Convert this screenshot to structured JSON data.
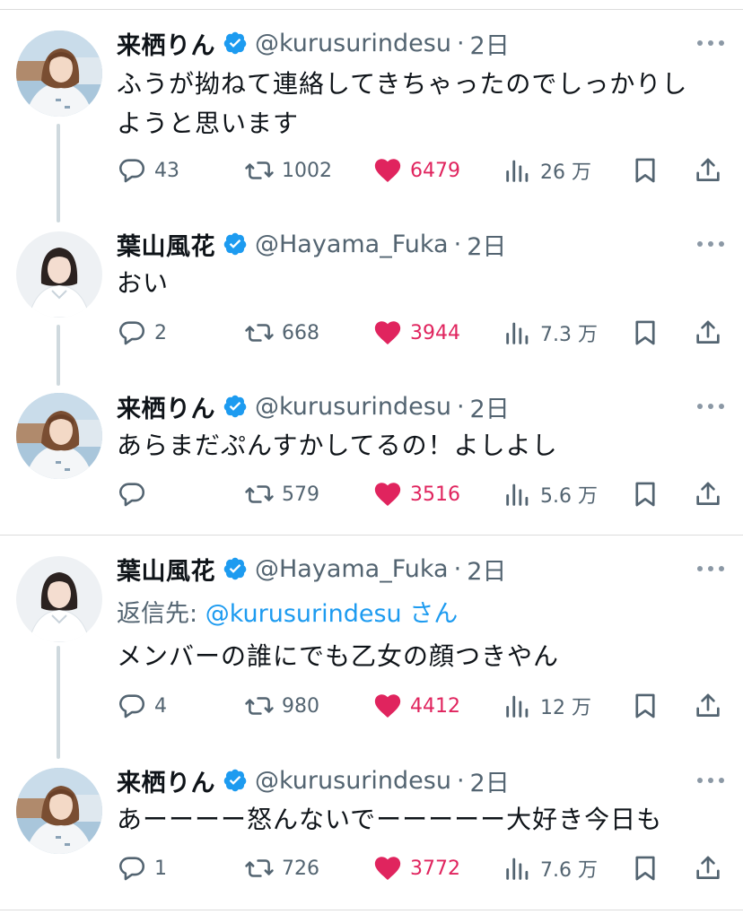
{
  "colors": {
    "accent": "#1d9bf0",
    "like": "#e0245e",
    "muted": "#536471",
    "text": "#0f1419"
  },
  "tweets": [
    {
      "name": "来栖りん",
      "handle": "@kurusurindesu",
      "dot": "·",
      "time": "2日",
      "text_lines": [
        "ふうが拗ねて連絡してきちゃったのでしっかりし",
        "ようと思います"
      ],
      "reply_count": "43",
      "retweet_count": "1002",
      "like_count": "6479",
      "view_count": "26 万"
    },
    {
      "name": "葉山風花",
      "handle": "@Hayama_Fuka",
      "dot": "·",
      "time": "2日",
      "text_lines": [
        "おい"
      ],
      "reply_count": "2",
      "retweet_count": "668",
      "like_count": "3944",
      "view_count": "7.3 万"
    },
    {
      "name": "来栖りん",
      "handle": "@kurusurindesu",
      "dot": "·",
      "time": "2日",
      "text_lines": [
        "あらまだぷんすかしてるの！よしよし"
      ],
      "reply_count": "",
      "retweet_count": "579",
      "like_count": "3516",
      "view_count": "5.6 万"
    },
    {
      "name": "葉山風花",
      "handle": "@Hayama_Fuka",
      "dot": "·",
      "time": "2日",
      "reply_to_prefix": "返信先: ",
      "reply_to_mention": "@kurusurindesu さん",
      "text_lines": [
        "メンバーの誰にでも乙女の顔つきやん"
      ],
      "reply_count": "4",
      "retweet_count": "980",
      "like_count": "4412",
      "view_count": "12 万"
    },
    {
      "name": "来栖りん",
      "handle": "@kurusurindesu",
      "dot": "·",
      "time": "2日",
      "text_lines": [
        "あーーーー怒んないでーーーーー大好き今日も"
      ],
      "reply_count": "1",
      "retweet_count": "726",
      "like_count": "3772",
      "view_count": "7.6 万"
    }
  ]
}
